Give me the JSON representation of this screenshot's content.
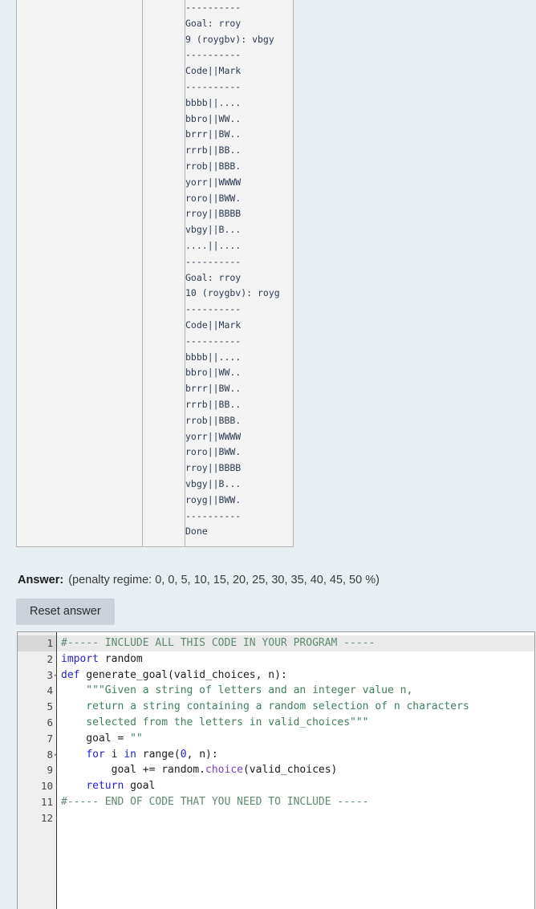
{
  "results_table": {
    "expected_column": "",
    "mid_column": "",
    "got_column_lines": [
      "----------",
      "Goal: rroy",
      "9 (roygbv): vbgy",
      "----------",
      "Code||Mark",
      "----------",
      "bbbb||....",
      "bbro||WW..",
      "brrr||BW..",
      "rrrb||BB..",
      "rrob||BBB.",
      "yorr||WWWW",
      "roro||BWW.",
      "rroy||BBBB",
      "vbgy||B...",
      "....||....",
      "----------",
      "Goal: rroy",
      "10 (roygbv): royg",
      "----------",
      "Code||Mark",
      "----------",
      "bbbb||....",
      "bbro||WW..",
      "brrr||BW..",
      "rrrb||BB..",
      "rrob||BBB.",
      "yorr||WWWW",
      "roro||BWW.",
      "rroy||BBBB",
      "vbgy||B...",
      "royg||BWW.",
      "----------",
      "Done"
    ]
  },
  "answer": {
    "label": "Answer:",
    "penalty_regime": "(penalty regime: 0, 0, 5, 10, 15, 20, 25, 30, 35, 40, 45, 50 %)",
    "reset_button": "Reset answer"
  },
  "editor": {
    "line_numbers": [
      "1",
      "2",
      "3",
      "4",
      "5",
      "6",
      "7",
      "8",
      "9",
      "10",
      "11",
      "12"
    ],
    "fold_markers": {
      "3": "▾",
      "8": "▾"
    },
    "active_line": 1,
    "lines": [
      "#----- INCLUDE ALL THIS CODE IN YOUR PROGRAM -----",
      "import random",
      "def generate_goal(valid_choices, n):",
      "    \"\"\"Given a string of letters and an integer value n,",
      "    return a string containing a random selection of n characters",
      "    selected from the letters in valid_choices\"\"\"",
      "    goal = \"\"",
      "    for i in range(0, n):",
      "        goal += random.choice(valid_choices)",
      "    return goal",
      "#----- END OF CODE THAT YOU NEED TO INCLUDE -----",
      ""
    ],
    "tokens": [
      [
        [
          "#----- INCLUDE ALL THIS CODE IN YOUR PROGRAM -----",
          "tok-comment"
        ]
      ],
      [
        [
          "import",
          "tok-kw"
        ],
        [
          " random",
          "tok-plain"
        ]
      ],
      [
        [
          "def",
          "tok-kw"
        ],
        [
          " generate_goal(valid_choices, n):",
          "tok-plain"
        ]
      ],
      [
        [
          "    \"\"\"Given a string of letters and an integer value n,",
          "tok-str"
        ]
      ],
      [
        [
          "    return a string containing a random selection of n characters",
          "tok-str"
        ]
      ],
      [
        [
          "    selected from the letters in valid_choices\"\"\"",
          "tok-str"
        ]
      ],
      [
        [
          "    goal = ",
          "tok-plain"
        ],
        [
          "\"\"",
          "tok-str"
        ]
      ],
      [
        [
          "    ",
          "tok-plain"
        ],
        [
          "for",
          "tok-kw"
        ],
        [
          " i ",
          "tok-plain"
        ],
        [
          "in",
          "tok-kw"
        ],
        [
          " range(",
          "tok-plain"
        ],
        [
          "0",
          "tok-num"
        ],
        [
          ", n):",
          "tok-plain"
        ]
      ],
      [
        [
          "        goal += random.",
          "tok-plain"
        ],
        [
          "choice",
          "tok-fn"
        ],
        [
          "(valid_choices)",
          "tok-plain"
        ]
      ],
      [
        [
          "    ",
          "tok-plain"
        ],
        [
          "return",
          "tok-kw"
        ],
        [
          " goal",
          "tok-plain"
        ]
      ],
      [
        [
          "#----- END OF CODE THAT YOU NEED TO INCLUDE -----",
          "tok-comment"
        ]
      ],
      [
        [
          "",
          "tok-plain"
        ]
      ]
    ]
  },
  "colors": {
    "page_background": "#e8eff2",
    "table_cell_background": "#f4f4f4",
    "table_border": "#b3b3b3",
    "button_background": "#ccd2d9",
    "editor_background": "#ffffff",
    "gutter_background": "#eeeeee",
    "active_line": "#eaeaea",
    "comment": "#5f8a70",
    "keyword": "#2424d0",
    "string": "#3f7f5f",
    "function": "#7a3fb8",
    "output_text": "#2b3a52"
  }
}
